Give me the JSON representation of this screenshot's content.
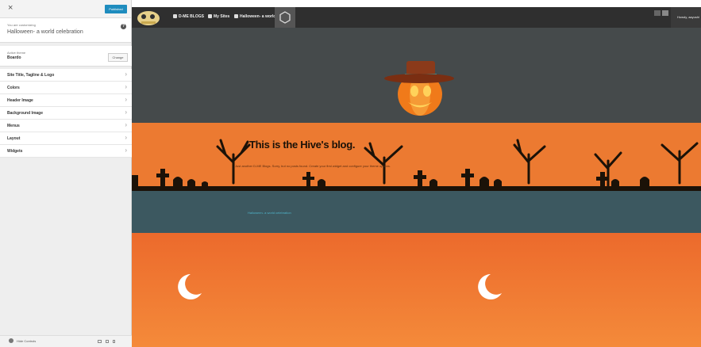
{
  "sidebar": {
    "close_symbol": "×",
    "publish_label": "Published",
    "customizing_label": "You are customizing",
    "site_title": "Halloween- a world celebration",
    "help_symbol": "?",
    "active_theme_label": "Active theme",
    "active_theme_name": "Boardo",
    "change_label": "Change",
    "items": [
      {
        "label": "Site Title, Tagline & Logo"
      },
      {
        "label": "Colors"
      },
      {
        "label": "Header Image"
      },
      {
        "label": "Background Image"
      },
      {
        "label": "Menus"
      },
      {
        "label": "Layout"
      },
      {
        "label": "Widgets"
      }
    ],
    "chevron_symbol": "›",
    "hide_controls_label": "Hide Controls"
  },
  "adminbar": {
    "item1": "D-ME BLOGS",
    "item2": "My Sites",
    "item3": "Halloween- a world...",
    "howdy": "Howdy, aayushi"
  },
  "hero": {
    "blog_title": "This is the Hive's blog.",
    "blog_desc": "Just another D-ME Blogs. Sorry, but no posts found. Create your first widget and configure your theme options."
  },
  "nav": {
    "link": "Halloween- a world celebration"
  },
  "colors": {
    "accent": "#1e8cbe",
    "header_band": "#454a4b",
    "orange": "#ec7a31",
    "nav_band": "#3c5860"
  }
}
